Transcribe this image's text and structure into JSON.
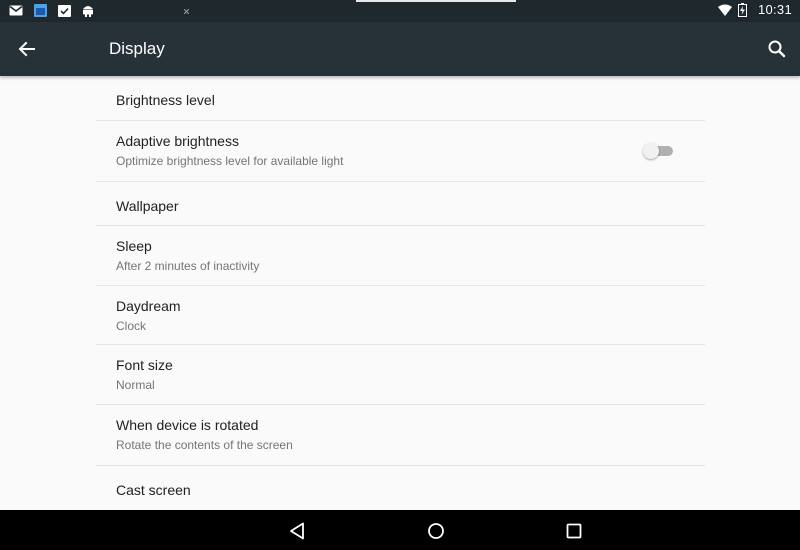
{
  "status_bar": {
    "time": "10:31",
    "icons": [
      "gmail-icon",
      "calendar-icon",
      "task-check-icon",
      "android-icon",
      "wifi-icon",
      "battery-charging-icon"
    ]
  },
  "app_bar": {
    "title": "Display",
    "back_icon": "arrow-back-icon",
    "search_icon": "search-icon"
  },
  "settings": [
    {
      "title": "Brightness level",
      "subtitle": ""
    },
    {
      "title": "Adaptive brightness",
      "subtitle": "Optimize brightness level for available light",
      "toggle": "off"
    },
    {
      "title": "Wallpaper",
      "subtitle": ""
    },
    {
      "title": "Sleep",
      "subtitle": "After 2 minutes of inactivity"
    },
    {
      "title": "Daydream",
      "subtitle": "Clock"
    },
    {
      "title": "Font size",
      "subtitle": "Normal"
    },
    {
      "title": "When device is rotated",
      "subtitle": "Rotate the contents of the screen"
    },
    {
      "title": "Cast screen",
      "subtitle": ""
    }
  ],
  "nav_bar": {
    "icons": [
      "back-triangle-icon",
      "home-circle-icon",
      "recents-square-icon"
    ]
  },
  "colors": {
    "app_bar": "#263238",
    "status_bar": "#1e282d",
    "background": "#fafafa",
    "divider": "#e4e4e4"
  }
}
